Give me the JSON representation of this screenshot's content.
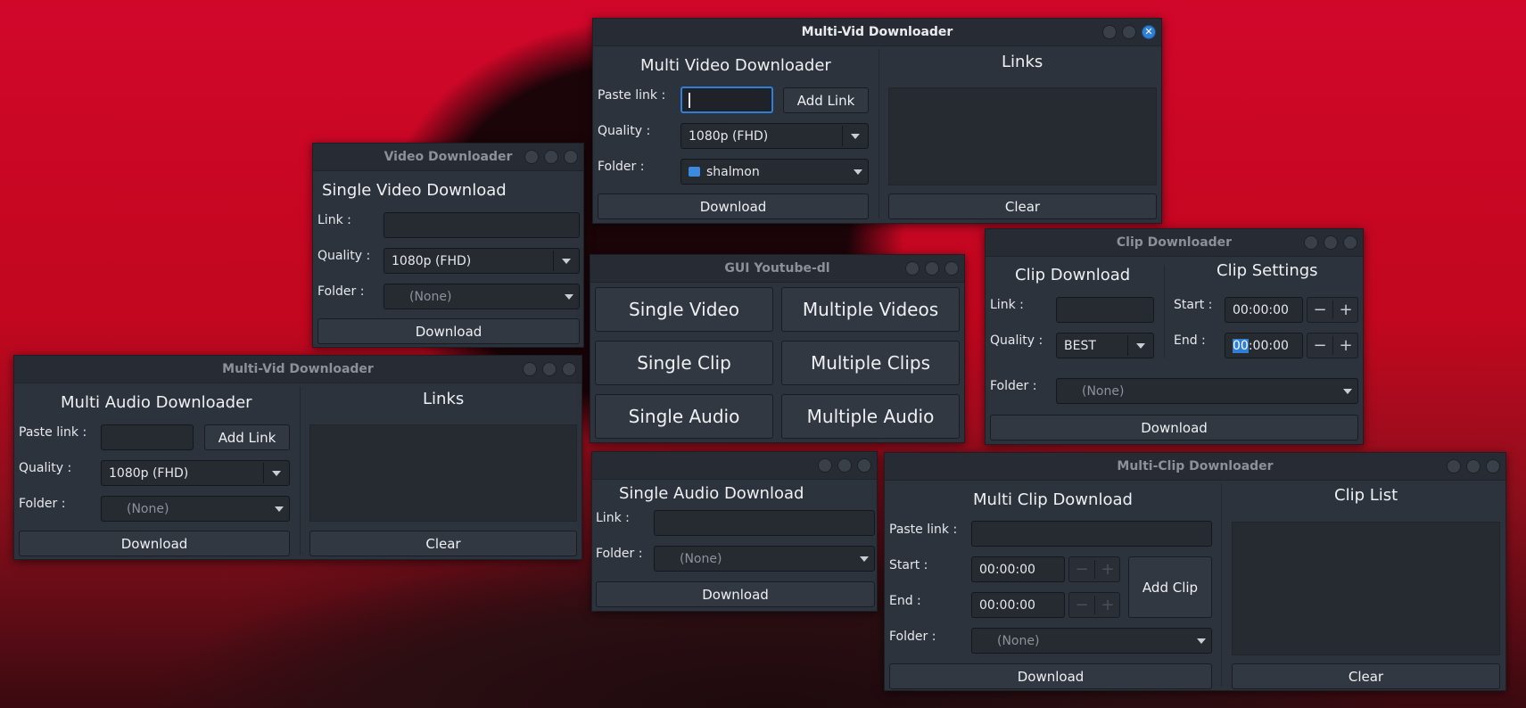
{
  "windows": {
    "multi_video": {
      "title": "Multi-Vid Downloader",
      "heading": "Multi Video Downloader",
      "paste_label": "Paste link :",
      "paste_value": "",
      "add_link": "Add Link",
      "quality_label": "Quality :",
      "quality_value": "1080p (FHD)",
      "folder_label": "Folder :",
      "folder_value": "shalmon",
      "download": "Download",
      "links_heading": "Links",
      "clear": "Clear"
    },
    "video": {
      "title": "Video Downloader",
      "heading": "Single Video Download",
      "link_label": "Link :",
      "quality_label": "Quality :",
      "quality_value": "1080p (FHD)",
      "folder_label": "Folder :",
      "folder_value": "(None)",
      "download": "Download"
    },
    "gui": {
      "title": "GUI Youtube-dl",
      "buttons": [
        "Single Video",
        "Multiple Videos",
        "Single Clip",
        "Multiple Clips",
        "Single Audio",
        "Multiple Audio"
      ]
    },
    "clip": {
      "title": "Clip Downloader",
      "heading": "Clip Download",
      "settings_heading": "Clip Settings",
      "link_label": "Link :",
      "quality_label": "Quality :",
      "quality_value": "BEST",
      "start_label": "Start :",
      "start_value": "00:00:00",
      "end_label": "End :",
      "end_value_selected": "00",
      "end_value_rest": ":00:00",
      "folder_label": "Folder :",
      "folder_value": "(None)",
      "download": "Download"
    },
    "multi_audio": {
      "title": "Multi-Vid Downloader",
      "heading": "Multi Audio Downloader",
      "paste_label": "Paste link :",
      "add_link": "Add Link",
      "quality_label": "Quality :",
      "quality_value": "1080p (FHD)",
      "folder_label": "Folder :",
      "folder_value": "(None)",
      "download": "Download",
      "links_heading": "Links",
      "clear": "Clear"
    },
    "audio": {
      "title": "",
      "heading": "Single Audio Download",
      "link_label": "Link :",
      "folder_label": "Folder :",
      "folder_value": "(None)",
      "download": "Download"
    },
    "multi_clip": {
      "title": "Multi-Clip Downloader",
      "heading": "Multi Clip Download",
      "list_heading": "Clip List",
      "paste_label": "Paste link :",
      "start_label": "Start :",
      "start_value": "00:00:00",
      "end_label": "End :",
      "end_value": "00:00:00",
      "add_clip": "Add Clip",
      "folder_label": "Folder :",
      "folder_value": "(None)",
      "download": "Download",
      "clear": "Clear"
    }
  },
  "icons": {
    "close": "close-icon",
    "minimize": "minimize-icon",
    "maximize": "maximize-icon",
    "folder": "home-folder-icon",
    "dropdown": "chevron-down-icon",
    "minus": "minus-icon",
    "plus": "plus-icon"
  },
  "colors": {
    "accent": "#2f7fd6",
    "window_bg": "#2d333c",
    "desktop_red": "#c2071f"
  }
}
